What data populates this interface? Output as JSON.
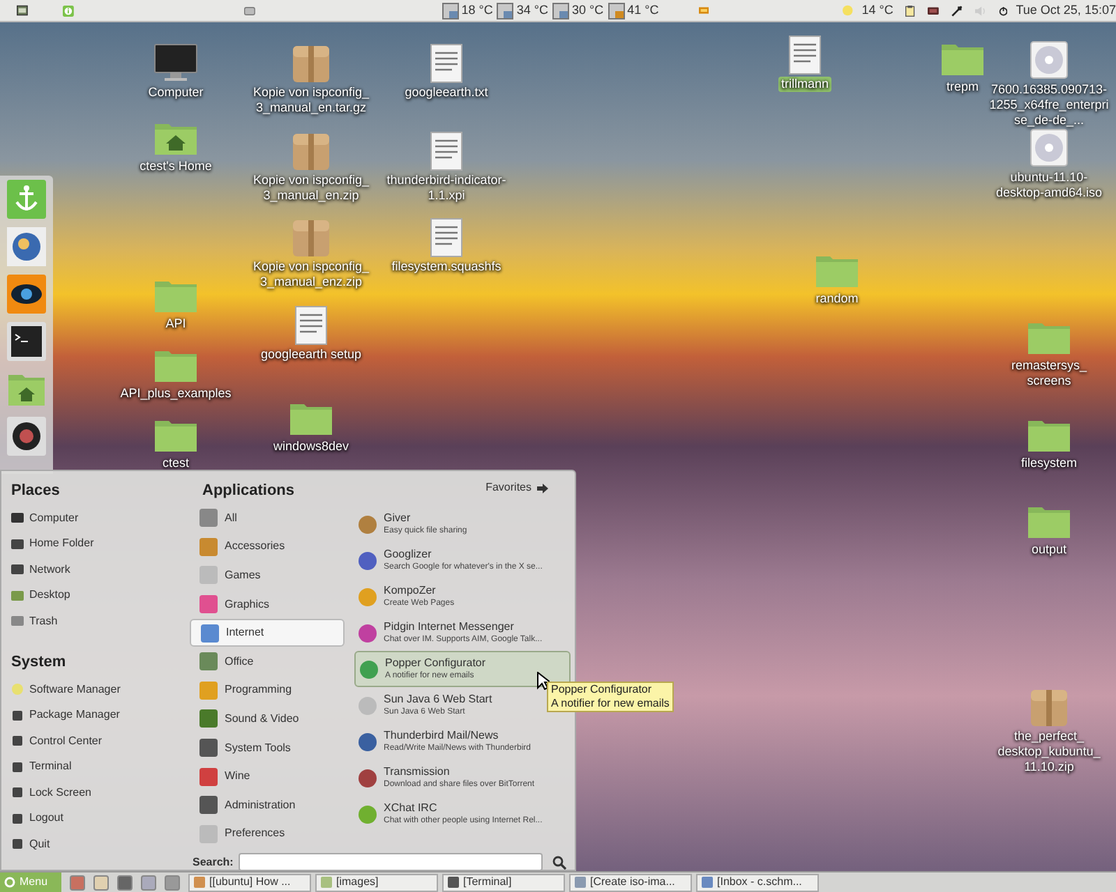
{
  "top_panel": {
    "temperatures": [
      "18 °C",
      "34 °C",
      "30 °C",
      "41 °C"
    ],
    "weather": "14 °C",
    "clock": "Tue Oct 25, 15:07"
  },
  "desktop_icons": [
    {
      "label": "Computer",
      "kind": "computer",
      "selected": false
    },
    {
      "label": "Kopie von ispconfig_ 3_manual_en.tar.gz",
      "kind": "archive",
      "selected": false
    },
    {
      "label": "googleearth.txt",
      "kind": "text",
      "selected": false
    },
    {
      "label": "ctest's Home",
      "kind": "home",
      "selected": false
    },
    {
      "label": "Kopie von ispconfig_ 3_manual_en.zip",
      "kind": "archive",
      "selected": false
    },
    {
      "label": "thunderbird-indicator-1.1.xpi",
      "kind": "text",
      "selected": false
    },
    {
      "label": "Kopie von ispconfig_ 3_manual_enz.zip",
      "kind": "archive",
      "selected": false
    },
    {
      "label": "filesystem.squashfs",
      "kind": "text",
      "selected": false
    },
    {
      "label": "API",
      "kind": "folder",
      "selected": false
    },
    {
      "label": "googleearth setup",
      "kind": "text",
      "selected": false
    },
    {
      "label": "API_plus_examples",
      "kind": "folder",
      "selected": false
    },
    {
      "label": "windows8dev",
      "kind": "folder",
      "selected": false
    },
    {
      "label": "ctest",
      "kind": "folder",
      "selected": false
    },
    {
      "label": "trillmann",
      "kind": "text",
      "selected": true
    },
    {
      "label": "trepm",
      "kind": "folder",
      "selected": false
    },
    {
      "label": "7600.16385.090713-1255_x64fre_enterprise_de-de_...",
      "kind": "disc",
      "selected": false
    },
    {
      "label": "ubuntu-11.10-desktop-amd64.iso",
      "kind": "disc",
      "selected": false
    },
    {
      "label": "random",
      "kind": "folder",
      "selected": false
    },
    {
      "label": "remastersys_ screens",
      "kind": "folder",
      "selected": false
    },
    {
      "label": "filesystem",
      "kind": "folder",
      "selected": false
    },
    {
      "label": "output",
      "kind": "folder",
      "selected": false
    },
    {
      "label": "the_perfect_ desktop_kubuntu_ 11.10.zip",
      "kind": "archive",
      "selected": false
    }
  ],
  "menu": {
    "places": {
      "title": "Places",
      "items": [
        "Computer",
        "Home Folder",
        "Network",
        "Desktop",
        "Trash"
      ]
    },
    "system": {
      "title": "System",
      "items": [
        "Software Manager",
        "Package Manager",
        "Control Center",
        "Terminal",
        "Lock Screen",
        "Logout",
        "Quit"
      ]
    },
    "applications": {
      "title": "Applications",
      "categories": [
        {
          "label": "All",
          "selected": false
        },
        {
          "label": "Accessories",
          "selected": false
        },
        {
          "label": "Games",
          "selected": false
        },
        {
          "label": "Graphics",
          "selected": false
        },
        {
          "label": "Internet",
          "selected": true
        },
        {
          "label": "Office",
          "selected": false
        },
        {
          "label": "Programming",
          "selected": false
        },
        {
          "label": "Sound & Video",
          "selected": false
        },
        {
          "label": "System Tools",
          "selected": false
        },
        {
          "label": "Wine",
          "selected": false
        },
        {
          "label": "Administration",
          "selected": false
        },
        {
          "label": "Preferences",
          "selected": false
        }
      ]
    },
    "favorites_button": "Favorites",
    "apps": [
      {
        "name": "Giver",
        "description": "Easy quick file sharing",
        "selected": false
      },
      {
        "name": "Googlizer",
        "description": "Search Google for whatever's in the X se...",
        "selected": false
      },
      {
        "name": "KompoZer",
        "description": "Create Web Pages",
        "selected": false
      },
      {
        "name": "Pidgin Internet Messenger",
        "description": "Chat over IM.  Supports AIM, Google Talk...",
        "selected": false
      },
      {
        "name": "Popper Configurator",
        "description": "A notifier for new emails",
        "selected": true
      },
      {
        "name": "Sun Java 6 Web Start",
        "description": "Sun Java 6 Web Start",
        "selected": false
      },
      {
        "name": "Thunderbird Mail/News",
        "description": "Read/Write Mail/News with Thunderbird",
        "selected": false
      },
      {
        "name": "Transmission",
        "description": "Download and share files over BitTorrent",
        "selected": false
      },
      {
        "name": "XChat IRC",
        "description": "Chat with other people using Internet Rel...",
        "selected": false
      }
    ],
    "search": {
      "label": "Search:"
    }
  },
  "tooltip": {
    "title": "Popper Configurator",
    "text": "A notifier for new emails"
  },
  "taskbar": {
    "menu_button": "Menu",
    "windows": [
      "[[ubuntu] How ...",
      "[images]",
      "[Terminal]",
      "[Create iso-ima...",
      "[Inbox - c.schm..."
    ]
  }
}
